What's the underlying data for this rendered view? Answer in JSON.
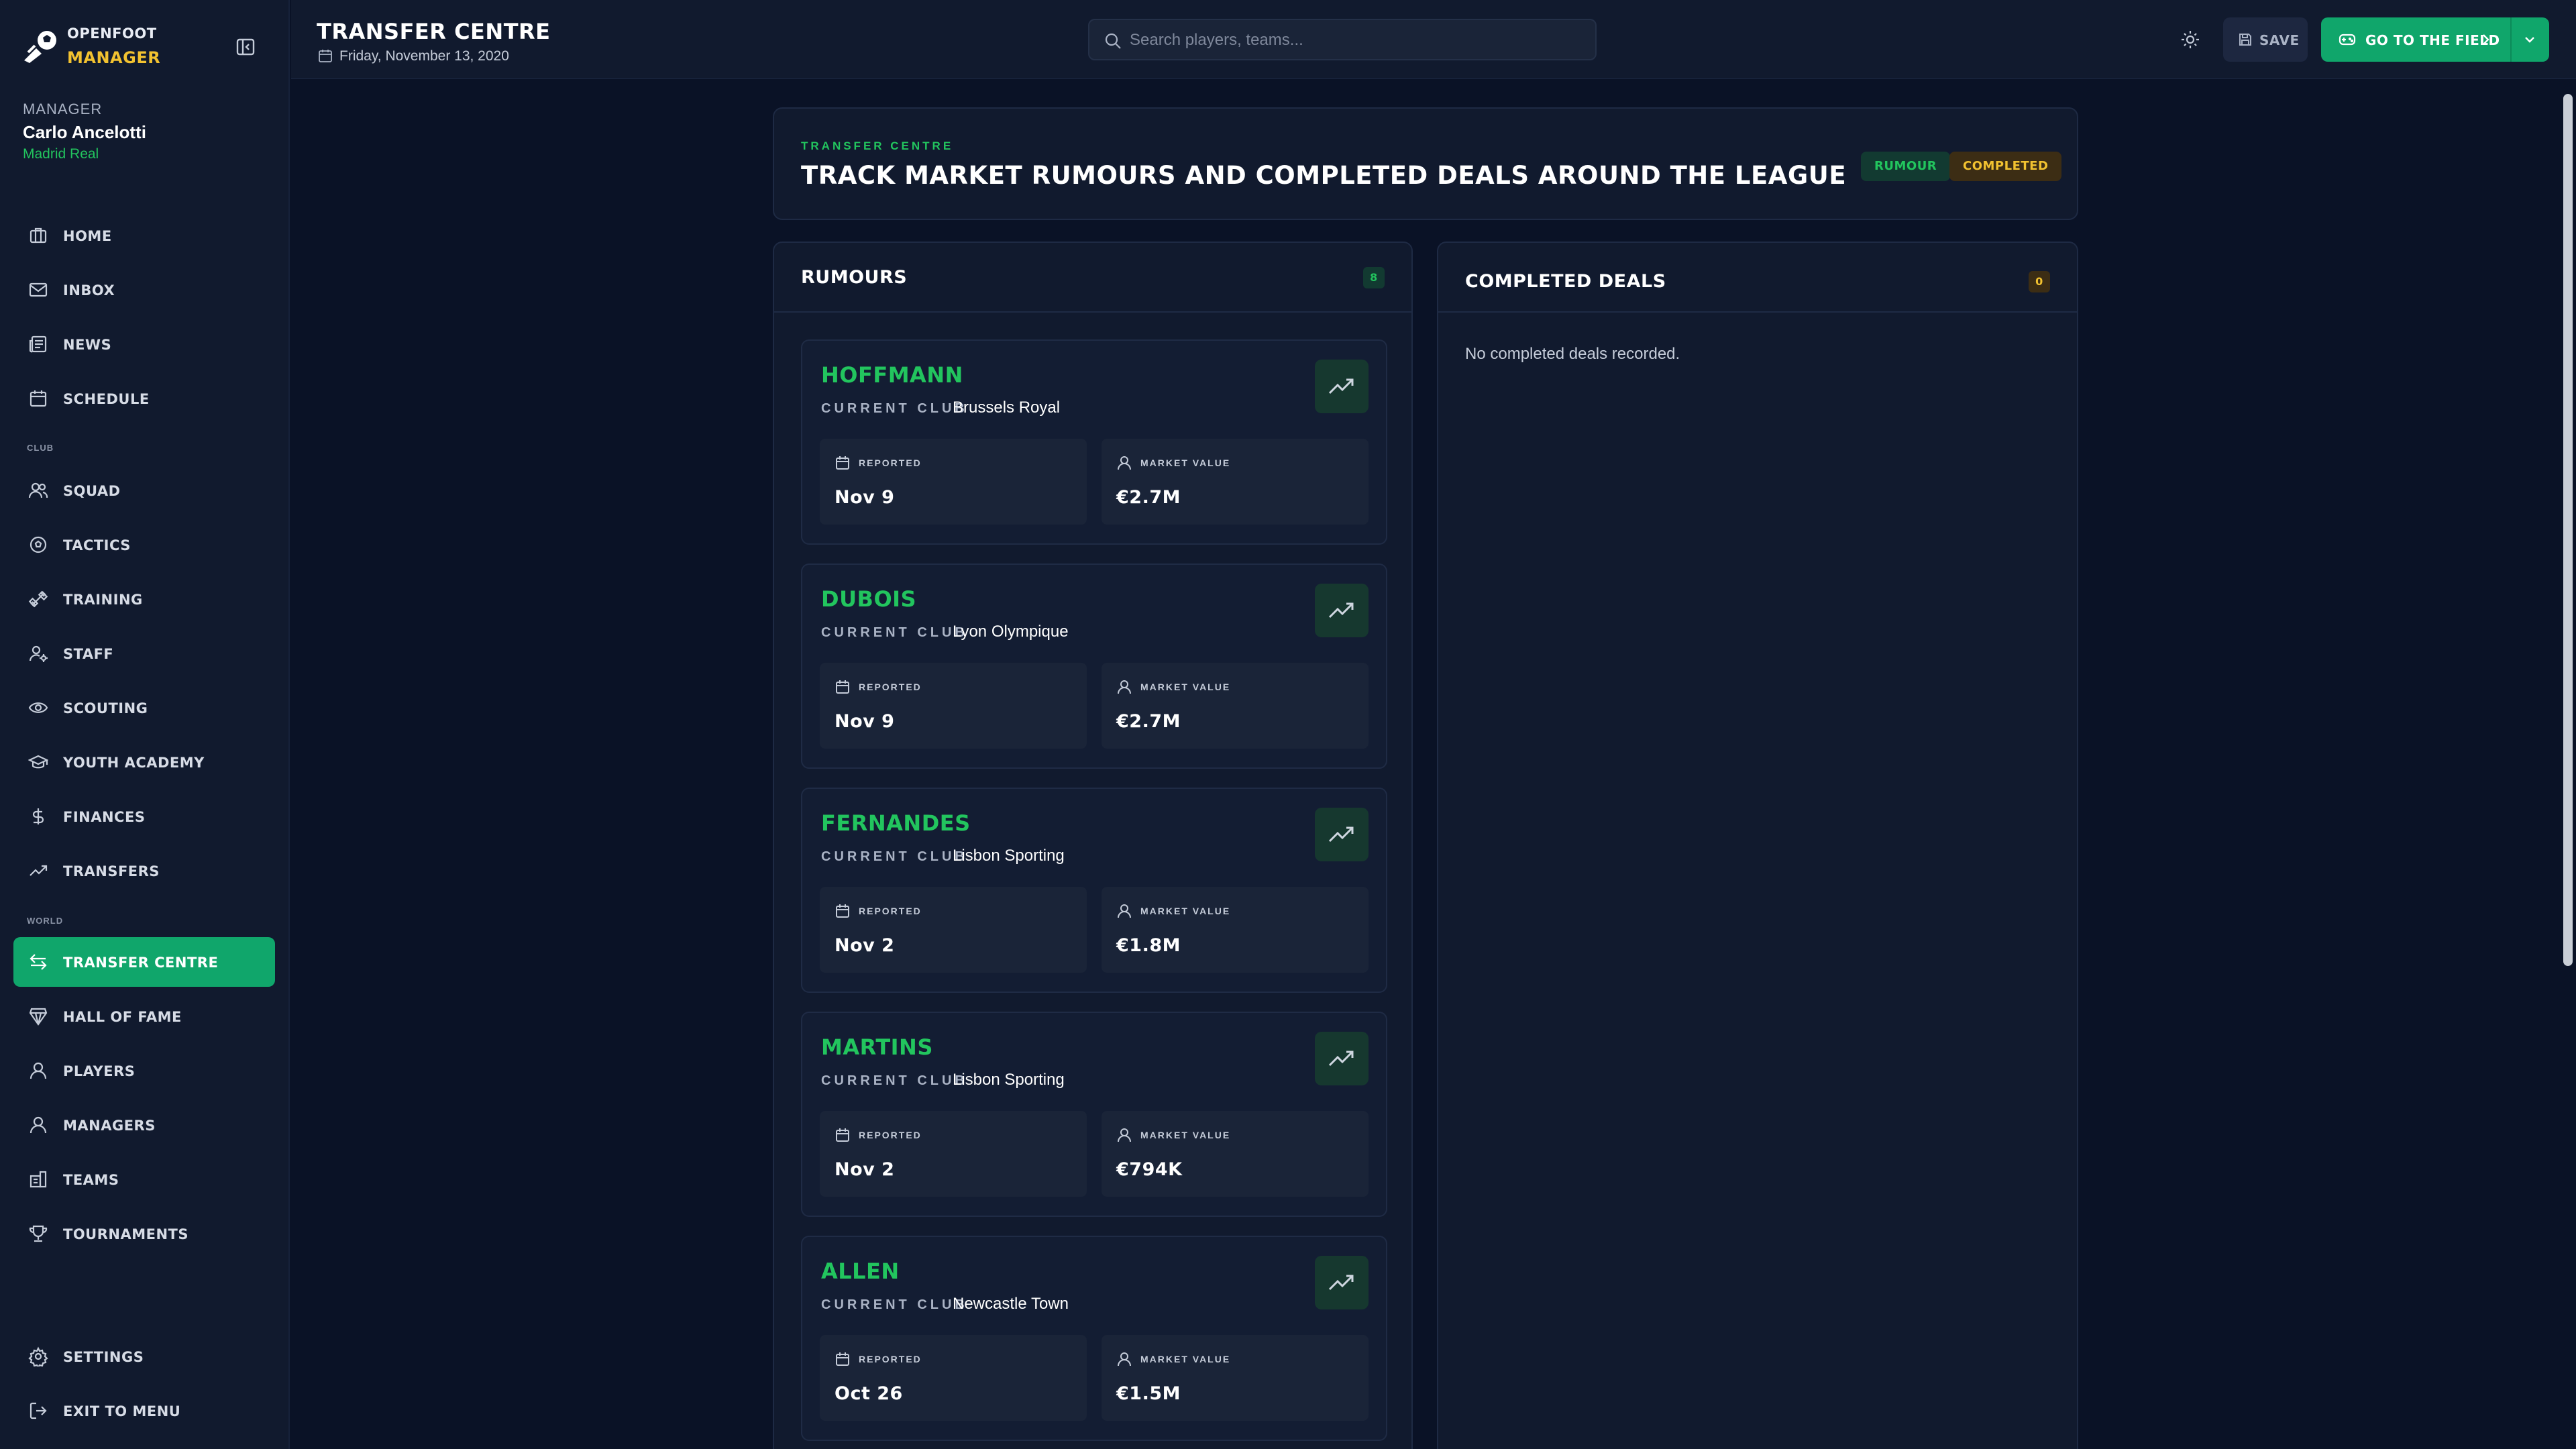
{
  "brand": {
    "line1": "OPENFOOT",
    "line2": "MANAGER"
  },
  "manager": {
    "label": "MANAGER",
    "name": "Carlo Ancelotti",
    "club": "Madrid Real"
  },
  "nav": {
    "home": "HOME",
    "inbox": "INBOX",
    "news": "NEWS",
    "schedule": "SCHEDULE",
    "club_section": "CLUB",
    "squad": "SQUAD",
    "tactics": "TACTICS",
    "training": "TRAINING",
    "staff": "STAFF",
    "scouting": "SCOUTING",
    "youth_academy": "YOUTH ACADEMY",
    "finances": "FINANCES",
    "transfers": "TRANSFERS",
    "world_section": "WORLD",
    "transfer_centre": "TRANSFER CENTRE",
    "hall_of_fame": "HALL OF FAME",
    "players": "PLAYERS",
    "managers": "MANAGERS",
    "teams": "TEAMS",
    "tournaments": "TOURNAMENTS",
    "settings": "SETTINGS",
    "exit": "EXIT TO MENU"
  },
  "topbar": {
    "title": "TRANSFER CENTRE",
    "date": "Friday, November 13, 2020",
    "search_placeholder": "Search players, teams...",
    "save_label": "SAVE",
    "field_label": "GO TO THE FIELD"
  },
  "hero": {
    "kicker": "TRANSFER CENTRE",
    "title": "TRACK MARKET RUMOURS AND COMPLETED DEALS AROUND THE LEAGUE",
    "badge_rumour": "RUMOUR",
    "badge_completed": "COMPLETED"
  },
  "rumours": {
    "title": "RUMOURS",
    "count": "8",
    "current_club_label": "CURRENT CLUB",
    "reported_label": "REPORTED",
    "market_value_label": "MARKET VALUE",
    "items": [
      {
        "name": "HOFFMANN",
        "club": "Brussels Royal",
        "reported": "Nov 9",
        "value": "€2.7M"
      },
      {
        "name": "DUBOIS",
        "club": "Lyon Olympique",
        "reported": "Nov 9",
        "value": "€2.7M"
      },
      {
        "name": "FERNANDES",
        "club": "Lisbon Sporting",
        "reported": "Nov 2",
        "value": "€1.8M"
      },
      {
        "name": "MARTINS",
        "club": "Lisbon Sporting",
        "reported": "Nov 2",
        "value": "€794K"
      },
      {
        "name": "ALLEN",
        "club": "Newcastle Town",
        "reported": "Oct 26",
        "value": "€1.5M"
      }
    ]
  },
  "completed": {
    "title": "COMPLETED DEALS",
    "count": "0",
    "empty": "No completed deals recorded."
  },
  "colors": {
    "accent": "#10a66b",
    "accent_text": "#22c55e",
    "gold": "#f2c230",
    "background": "#0a1226",
    "panel": "#111a2e"
  }
}
